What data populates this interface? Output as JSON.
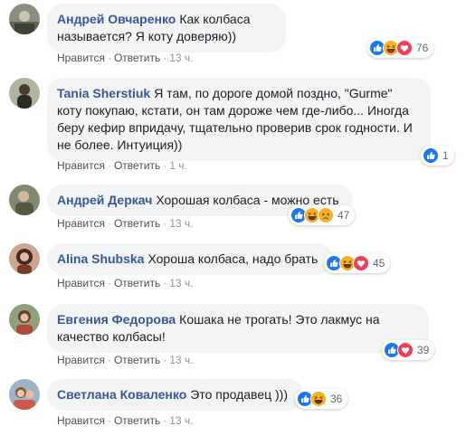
{
  "comments": [
    {
      "author": "Андрей Овчаренко",
      "text": "Как колбаса называется? Я коту доверяю))",
      "reactions": [
        "like",
        "haha",
        "love"
      ],
      "reaction_count": "76",
      "like_label": "Нравится",
      "reply_label": "Ответить",
      "time": "13 ч."
    },
    {
      "author": "Tania Sherstiuk",
      "text": "Я там, по дороге домой поздно, \"Gurme\" коту покупаю, кстати, он там дороже чем где-либо... Иногда беру кефир впридачу, тщательно проверив срок годности. И не более. Интуиция))",
      "reactions": [
        "like"
      ],
      "reaction_count": "1",
      "like_label": "Нравится",
      "reply_label": "Ответить",
      "time": "1 ч."
    },
    {
      "author": "Андрей Деркач",
      "text": "Хорошая колбаса - можно есть",
      "reactions": [
        "like",
        "haha",
        "sad"
      ],
      "reaction_count": "47",
      "like_label": "Нравится",
      "reply_label": "Ответить",
      "time": "13 ч."
    },
    {
      "author": "Alina Shubska",
      "text": "Хороша колбаса, надо брать",
      "reactions": [
        "like",
        "haha",
        "love"
      ],
      "reaction_count": "45",
      "like_label": "Нравится",
      "reply_label": "Ответить",
      "time": "13 ч."
    },
    {
      "author": "Евгения Федорова",
      "text": "Кошака не трогать! Это лакмус на качество колбасы!",
      "reactions": [
        "like",
        "love"
      ],
      "reaction_count": "39",
      "like_label": "Нравится",
      "reply_label": "Ответить",
      "time": "13 ч."
    },
    {
      "author": "Светлана Коваленко",
      "text": "Это продавец )))",
      "reactions": [
        "like",
        "haha"
      ],
      "reaction_count": "36",
      "like_label": "Нравится",
      "reply_label": "Ответить",
      "time": "13 ч."
    }
  ],
  "colors": {
    "author": "#385898",
    "bubble": "#f2f3f5",
    "like": "#1877f2",
    "love": "#f33e58",
    "haha": "#f7b125"
  }
}
